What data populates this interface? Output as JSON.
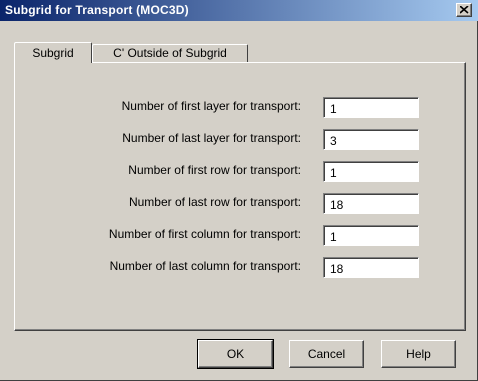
{
  "window": {
    "title": "Subgrid for Transport (MOC3D)"
  },
  "tabs": [
    {
      "label": "Subgrid"
    },
    {
      "label": "C' Outside of Subgrid"
    }
  ],
  "fields": [
    {
      "label": "Number of first layer for transport:",
      "value": "1"
    },
    {
      "label": "Number of last layer for transport:",
      "value": "3"
    },
    {
      "label": "Number of first row for transport:",
      "value": "1"
    },
    {
      "label": "Number of last row for transport:",
      "value": "18"
    },
    {
      "label": "Number of first column for transport:",
      "value": "1"
    },
    {
      "label": "Number of last column for transport:",
      "value": "18"
    }
  ],
  "buttons": {
    "ok": "OK",
    "cancel": "Cancel",
    "help": "Help"
  },
  "colors": {
    "titlebar_start": "#0a246a",
    "titlebar_end": "#a6caf0",
    "face": "#d4d0c8"
  }
}
